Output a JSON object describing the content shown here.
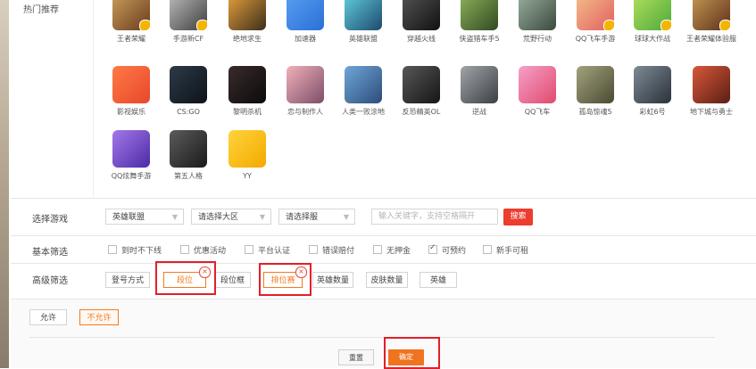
{
  "hot_section": {
    "label": "热门推荐",
    "games": [
      {
        "name": "王者荣耀",
        "icon": "hero-icon",
        "colors": [
          "#c9a05a",
          "#6b3a1e"
        ],
        "badge": true
      },
      {
        "name": "手游新CF",
        "icon": "soldier-icon",
        "colors": [
          "#bdbdbd",
          "#3e3e3e"
        ],
        "badge": true
      },
      {
        "name": "绝地求生",
        "icon": "pubg-icon",
        "colors": [
          "#e8a23c",
          "#3d2e1b"
        ],
        "badge": false
      },
      {
        "name": "加速器",
        "icon": "lightning-icon",
        "colors": [
          "#5aa0f2",
          "#2a6fd6"
        ],
        "badge": false
      },
      {
        "name": "英雄联盟",
        "icon": "lol-icon",
        "colors": [
          "#63d0e0",
          "#1d4a6e"
        ],
        "badge": false
      },
      {
        "name": "穿越火线",
        "icon": "cf-icon",
        "colors": [
          "#555555",
          "#111111"
        ],
        "badge": false
      },
      {
        "name": "侠盗猎车手5",
        "icon": "gta-icon",
        "colors": [
          "#8fb35a",
          "#2f4a22"
        ],
        "badge": false
      },
      {
        "name": "荒野行动",
        "icon": "gun-icon",
        "colors": [
          "#9bb0a0",
          "#3a4a3c"
        ],
        "badge": false
      },
      {
        "name": "QQ飞车手游",
        "icon": "racer-icon",
        "colors": [
          "#f3c08a",
          "#e25e62"
        ],
        "badge": true
      },
      {
        "name": "球球大作战",
        "icon": "ball-icon",
        "colors": [
          "#b4e05e",
          "#4ca93a"
        ],
        "badge": true
      },
      {
        "name": "王者荣耀体验服",
        "icon": "hero-icon",
        "colors": [
          "#c69b55",
          "#5e2f1a"
        ],
        "badge": true
      },
      {
        "name": "影视娱乐",
        "icon": "player-icon",
        "colors": [
          "#ff7a45",
          "#e8472c"
        ],
        "badge": false
      },
      {
        "name": "CS:GO",
        "icon": "csgo-icon",
        "colors": [
          "#2d3b48",
          "#0d1218"
        ],
        "badge": false
      },
      {
        "name": "黎明杀机",
        "icon": "dbd-icon",
        "colors": [
          "#3a2a2a",
          "#0b0b0b"
        ],
        "badge": false
      },
      {
        "name": "恋与制作人",
        "icon": "romance-icon",
        "colors": [
          "#f2b0b8",
          "#7c4e6a"
        ],
        "badge": false
      },
      {
        "name": "人类一败涂地",
        "icon": "human-icon",
        "colors": [
          "#6fa6d9",
          "#2c4d78"
        ],
        "badge": false
      },
      {
        "name": "反恐精英OL",
        "icon": "csol-icon",
        "colors": [
          "#585858",
          "#151515"
        ],
        "badge": false
      },
      {
        "name": "逆战",
        "icon": "warrior-icon",
        "colors": [
          "#a1a5a8",
          "#3b3f44"
        ],
        "badge": false
      },
      {
        "name": "QQ飞车",
        "icon": "racer-icon",
        "colors": [
          "#f5a0c8",
          "#e14a6e"
        ],
        "badge": false
      },
      {
        "name": "孤岛惊魂5",
        "icon": "farcry-icon",
        "colors": [
          "#a3a27e",
          "#4a4a33"
        ],
        "badge": false
      },
      {
        "name": "彩虹6号",
        "icon": "r6-icon",
        "colors": [
          "#7e8a95",
          "#2a323a"
        ],
        "badge": false
      },
      {
        "name": "地下城与勇士",
        "icon": "dnf-icon",
        "colors": [
          "#d9583a",
          "#5a1e14"
        ],
        "badge": false
      },
      {
        "name": "QQ炫舞手游",
        "icon": "dance-icon",
        "colors": [
          "#a478e8",
          "#4b2ba7"
        ],
        "badge": false
      },
      {
        "name": "第五人格",
        "icon": "idv-icon",
        "colors": [
          "#5b5b5b",
          "#1a1a1a"
        ],
        "badge": false
      },
      {
        "name": "YY",
        "icon": "yy-icon",
        "colors": [
          "#ffd43b",
          "#f2a900"
        ],
        "badge": false
      }
    ]
  },
  "select_game": {
    "label": "选择游戏",
    "game_select": "英雄联盟",
    "region_select": "请选择大区",
    "server_select": "请选择服",
    "keyword_placeholder": "输入关键字，支持空格隔开",
    "search_button": "搜索"
  },
  "basic_filter": {
    "label": "基本筛选",
    "options": [
      {
        "label": "到时不下线",
        "checked": false
      },
      {
        "label": "优惠活动",
        "checked": false
      },
      {
        "label": "平台认证",
        "checked": false
      },
      {
        "label": "错误赔付",
        "checked": false
      },
      {
        "label": "无押金",
        "checked": false
      },
      {
        "label": "可预约",
        "checked": true
      },
      {
        "label": "新手可租",
        "checked": false
      }
    ]
  },
  "advanced_filter": {
    "label": "高级筛选",
    "tags": [
      {
        "label": "登号方式",
        "active": false
      },
      {
        "label": "段位",
        "active": true
      },
      {
        "label": "段位框",
        "active": false
      },
      {
        "label": "排位赛",
        "active": true
      },
      {
        "label": "英雄数量",
        "active": false
      },
      {
        "label": "皮肤数量",
        "active": false
      },
      {
        "label": "英雄",
        "active": false
      }
    ],
    "remove_symbol": "×"
  },
  "allow_options": {
    "allow": "允许",
    "disallow": "不允许",
    "selected": "不允许"
  },
  "actions": {
    "reset": "重置",
    "confirm": "确定"
  },
  "colors": {
    "accent": "#f07b22",
    "search_red": "#ec3d2e",
    "highlight_red": "#e0202a"
  }
}
